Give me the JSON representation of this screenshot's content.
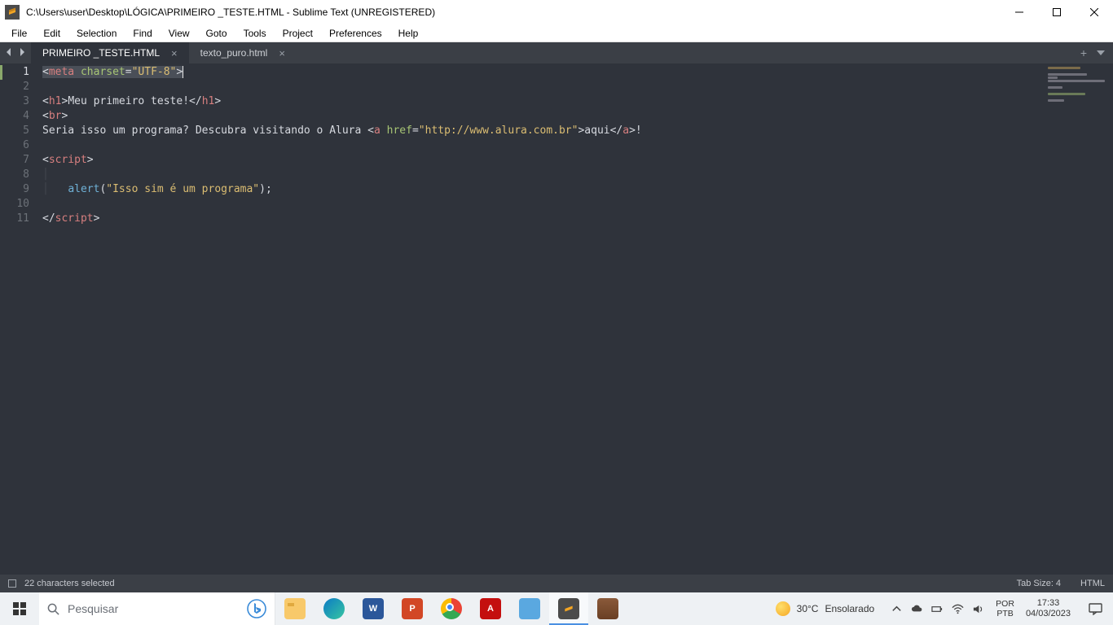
{
  "window": {
    "title": "C:\\Users\\user\\Desktop\\LÓGICA\\PRIMEIRO _TESTE.HTML - Sublime Text (UNREGISTERED)"
  },
  "menu": {
    "items": [
      "File",
      "Edit",
      "Selection",
      "Find",
      "View",
      "Goto",
      "Tools",
      "Project",
      "Preferences",
      "Help"
    ]
  },
  "tabs": {
    "active": "PRIMEIRO _TESTE.HTML",
    "inactive": "texto_puro.html"
  },
  "code": {
    "line1_tag": "meta",
    "line1_attr": "charset",
    "line1_val": "\"UTF-8\"",
    "line3_open": "h1",
    "line3_text": "Meu primeiro teste!",
    "line3_close": "h1",
    "line4_tag": "br",
    "line5_pretext": "Seria isso um programa? Descubra visitando o Alura ",
    "line5_tag": "a",
    "line5_attr": "href",
    "line5_val": "\"http://www.alura.com.br\"",
    "line5_linktext": "aqui",
    "line5_trail": "!",
    "line7_tag": "script",
    "line9_fn": "alert",
    "line9_arg": "\"Isso sim é um programa\"",
    "line11_tag": "script"
  },
  "status": {
    "selection": "22 characters selected",
    "tabsize": "Tab Size: 4",
    "syntax": "HTML"
  },
  "taskbar": {
    "search_placeholder": "Pesquisar",
    "weather_temp": "30°C",
    "weather_cond": "Ensolarado",
    "lang1": "POR",
    "lang2": "PTB",
    "time": "17:33",
    "date": "04/03/2023"
  }
}
